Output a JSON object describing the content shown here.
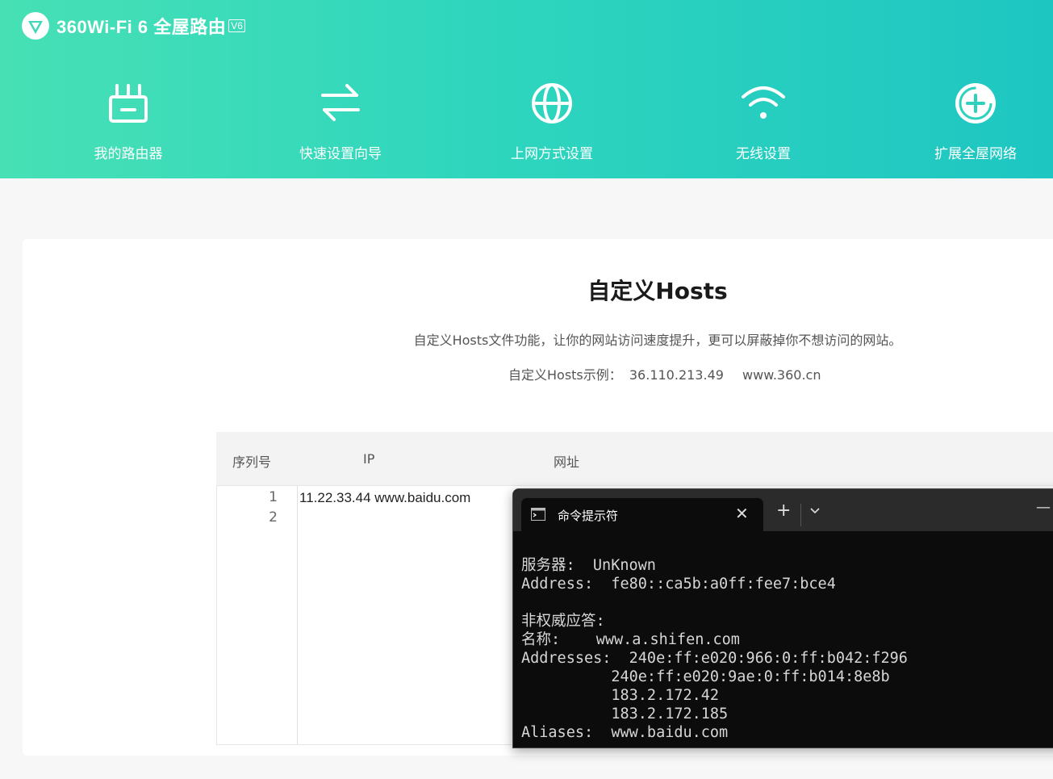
{
  "header": {
    "logo_text": "360Wi-Fi 6 全屋路由",
    "logo_badge": "V6",
    "nav": [
      {
        "label": "我的路由器",
        "icon": "router-icon"
      },
      {
        "label": "快速设置向导",
        "icon": "arrows-swap-icon"
      },
      {
        "label": "上网方式设置",
        "icon": "globe-icon"
      },
      {
        "label": "无线设置",
        "icon": "wifi-icon"
      },
      {
        "label": "扩展全屋网络",
        "icon": "plus-circle-icon"
      }
    ]
  },
  "main": {
    "title": "自定义Hosts",
    "description": "自定义Hosts文件功能，让你的网站访问速度提升，更可以屏蔽掉你不想访问的网站。",
    "example_label": "自定义Hosts示例：",
    "example_ip": "36.110.213.49",
    "example_url": "www.360.cn",
    "table": {
      "col_index": "序列号",
      "col_ip": "IP",
      "col_url": "网址",
      "line_numbers": [
        "1",
        "2"
      ],
      "lines": [
        "11.22.33.44 www.baidu.com",
        ""
      ]
    }
  },
  "terminal": {
    "tab_title": "命令提示符",
    "close": "✕",
    "add": "+",
    "minimize": "—",
    "lines": [
      "服务器:  UnKnown",
      "Address:  fe80::ca5b:a0ff:fee7:bce4",
      "",
      "非权威应答:",
      "名称:    www.a.shifen.com",
      "Addresses:  240e:ff:e020:966:0:ff:b042:f296",
      "          240e:ff:e020:9ae:0:ff:b014:8e8b",
      "          183.2.172.42",
      "          183.2.172.185",
      "Aliases:  www.baidu.com"
    ]
  },
  "colors": {
    "header_start": "#47e0b5",
    "header_end": "#1ec6c2",
    "terminal_bg": "#0c0c0c"
  }
}
